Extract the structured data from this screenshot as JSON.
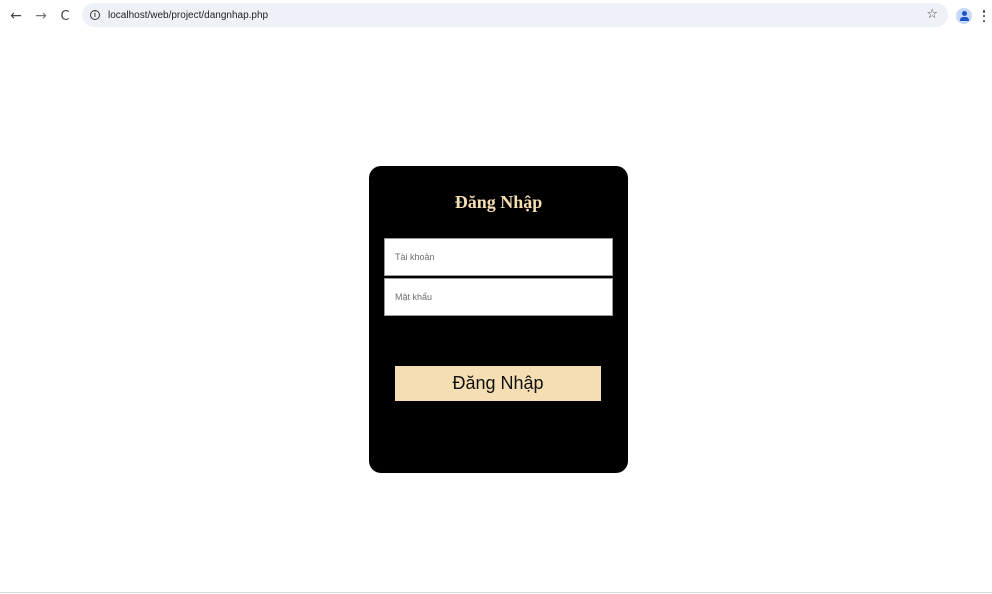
{
  "browser": {
    "back_glyph": "←",
    "forward_glyph": "→",
    "reload_glyph": "C",
    "url": "localhost/web/project/dangnhap.php",
    "info_glyph": "i",
    "star_glyph": "☆",
    "icons": [
      "back-icon",
      "forward-icon",
      "reload-icon",
      "info-icon",
      "bookmark-star-icon",
      "profile-icon",
      "menu-icon"
    ]
  },
  "login": {
    "title": "Đăng Nhập",
    "username_placeholder": "Tài khoản",
    "password_placeholder": "Mật khẩu",
    "submit_label": "Đăng Nhập",
    "colors": {
      "card_background": "#000000",
      "accent": "#f5deb3",
      "field_background": "#ffffff"
    }
  }
}
